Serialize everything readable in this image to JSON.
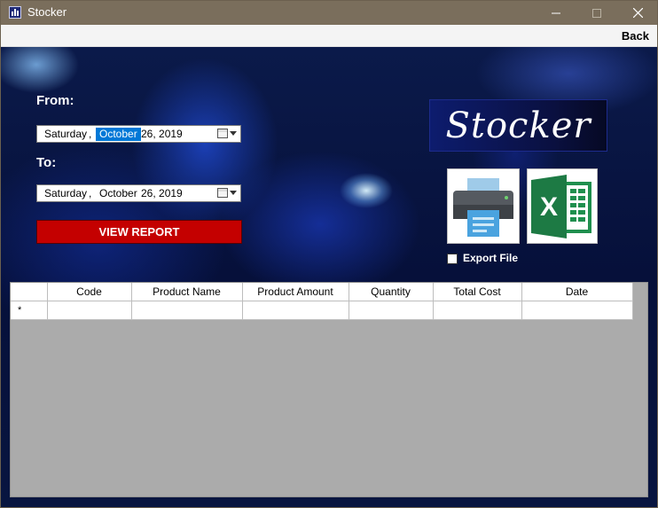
{
  "window": {
    "title": "Stocker",
    "app_icon": "bar-chart-icon"
  },
  "menubar": {
    "back_label": "Back"
  },
  "report_filter": {
    "from_label": "From:",
    "from_date": {
      "day": "Saturday",
      "month": "October",
      "day_num_year": "26, 2019",
      "comma": ","
    },
    "to_label": "To:",
    "to_date": {
      "day": "Saturday",
      "month": "October",
      "day_num_year": "26, 2019",
      "comma": ","
    },
    "view_report_label": "VIEW REPORT"
  },
  "brand": {
    "logo_text": "Stocker"
  },
  "export": {
    "print_icon": "printer-icon",
    "excel_icon": "excel-icon",
    "export_file_label": "Export File",
    "export_file_checked": false
  },
  "grid": {
    "columns": [
      "Code",
      "Product Name",
      "Product Amount",
      "Quantity",
      "Total Cost",
      "Date"
    ],
    "new_row_marker": "*",
    "rows": []
  },
  "colors": {
    "accent_red": "#c40000",
    "title_bar": "#7a6e5c",
    "grid_bg": "#ababab"
  }
}
